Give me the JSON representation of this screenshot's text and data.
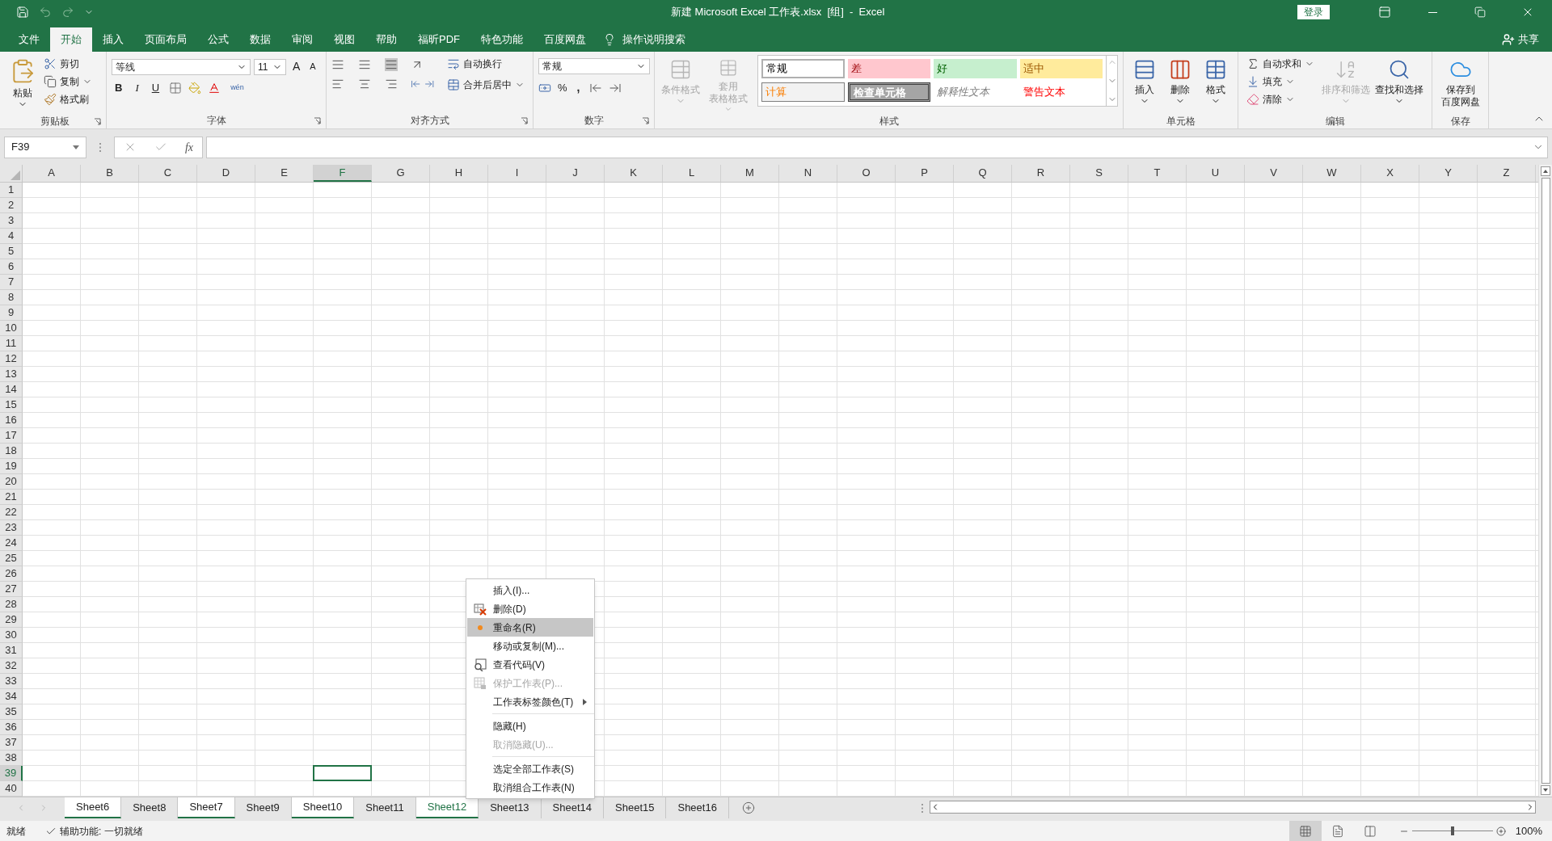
{
  "title_bar": {
    "title": "新建 Microsoft Excel 工作表.xlsx  [组]  -  Excel",
    "sign_in": "登录"
  },
  "menu_tabs": [
    {
      "label": "文件",
      "selected": false
    },
    {
      "label": "开始",
      "selected": true
    },
    {
      "label": "插入",
      "selected": false
    },
    {
      "label": "页面布局",
      "selected": false
    },
    {
      "label": "公式",
      "selected": false
    },
    {
      "label": "数据",
      "selected": false
    },
    {
      "label": "审阅",
      "selected": false
    },
    {
      "label": "视图",
      "selected": false
    },
    {
      "label": "帮助",
      "selected": false
    },
    {
      "label": "福昕PDF",
      "selected": false
    },
    {
      "label": "特色功能",
      "selected": false
    },
    {
      "label": "百度网盘",
      "selected": false
    }
  ],
  "tell_me": "操作说明搜索",
  "share": "共享",
  "ribbon": {
    "clipboard": {
      "label": "剪贴板",
      "paste": "粘贴",
      "cut": "剪切",
      "copy": "复制",
      "format_painter": "格式刷"
    },
    "font": {
      "label": "字体",
      "font_name": "等线",
      "font_size": "11",
      "grow": "A",
      "shrink": "A",
      "bold": "B",
      "italic": "I",
      "underline": "U",
      "phonetic": "wén"
    },
    "alignment": {
      "label": "对齐方式",
      "wrap_text": "自动换行",
      "merge_center": "合并后居中"
    },
    "number": {
      "label": "数字",
      "format": "常规",
      "percent": "%",
      "comma": ","
    },
    "styles": {
      "label": "样式",
      "conditional_formatting": {
        "label": "条件格式",
        "disabled": true
      },
      "format_as_table": {
        "label": "套用",
        "label2": "表格格式",
        "disabled": true
      },
      "cell_styles": [
        {
          "label": "常规",
          "kind": "normal"
        },
        {
          "label": "差",
          "kind": "bad"
        },
        {
          "label": "好",
          "kind": "good"
        },
        {
          "label": "适中",
          "kind": "neutral"
        },
        {
          "label": "计算",
          "kind": "calculation"
        },
        {
          "label": "检查单元格",
          "kind": "check"
        },
        {
          "label": "解释性文本",
          "kind": "explanatory"
        },
        {
          "label": "警告文本",
          "kind": "warning"
        }
      ]
    },
    "cells": {
      "label": "单元格",
      "insert": "插入",
      "delete": "删除",
      "format": "格式"
    },
    "editing": {
      "label": "编辑",
      "autosum": "自动求和",
      "fill": "填充",
      "clear": "清除",
      "sort_filter": {
        "label": "排序和筛选",
        "disabled": true
      },
      "find_select": "查找和选择"
    },
    "save": {
      "label": "保存",
      "button": "保存到",
      "button2": "百度网盘"
    }
  },
  "formula_bar": {
    "name_box": "F39",
    "fx": "fx"
  },
  "columns": [
    {
      "label": "A",
      "selected": false
    },
    {
      "label": "B",
      "selected": false
    },
    {
      "label": "C",
      "selected": false
    },
    {
      "label": "D",
      "selected": false
    },
    {
      "label": "E",
      "selected": false
    },
    {
      "label": "F",
      "selected": true
    },
    {
      "label": "G",
      "selected": false
    },
    {
      "label": "H",
      "selected": false
    },
    {
      "label": "I",
      "selected": false
    },
    {
      "label": "J",
      "selected": false
    },
    {
      "label": "K",
      "selected": false
    },
    {
      "label": "L",
      "selected": false
    },
    {
      "label": "M",
      "selected": false
    },
    {
      "label": "N",
      "selected": false
    },
    {
      "label": "O",
      "selected": false
    },
    {
      "label": "P",
      "selected": false
    },
    {
      "label": "Q",
      "selected": false
    },
    {
      "label": "R",
      "selected": false
    },
    {
      "label": "S",
      "selected": false
    },
    {
      "label": "T",
      "selected": false
    },
    {
      "label": "U",
      "selected": false
    },
    {
      "label": "V",
      "selected": false
    },
    {
      "label": "W",
      "selected": false
    },
    {
      "label": "X",
      "selected": false
    },
    {
      "label": "Y",
      "selected": false
    },
    {
      "label": "Z",
      "selected": false
    }
  ],
  "rows": [
    {
      "label": "1",
      "selected": false
    },
    {
      "label": "2",
      "selected": false
    },
    {
      "label": "3",
      "selected": false
    },
    {
      "label": "4",
      "selected": false
    },
    {
      "label": "5",
      "selected": false
    },
    {
      "label": "6",
      "selected": false
    },
    {
      "label": "7",
      "selected": false
    },
    {
      "label": "8",
      "selected": false
    },
    {
      "label": "9",
      "selected": false
    },
    {
      "label": "10",
      "selected": false
    },
    {
      "label": "11",
      "selected": false
    },
    {
      "label": "12",
      "selected": false
    },
    {
      "label": "13",
      "selected": false
    },
    {
      "label": "14",
      "selected": false
    },
    {
      "label": "15",
      "selected": false
    },
    {
      "label": "16",
      "selected": false
    },
    {
      "label": "17",
      "selected": false
    },
    {
      "label": "18",
      "selected": false
    },
    {
      "label": "19",
      "selected": false
    },
    {
      "label": "20",
      "selected": false
    },
    {
      "label": "21",
      "selected": false
    },
    {
      "label": "22",
      "selected": false
    },
    {
      "label": "23",
      "selected": false
    },
    {
      "label": "24",
      "selected": false
    },
    {
      "label": "25",
      "selected": false
    },
    {
      "label": "26",
      "selected": false
    },
    {
      "label": "27",
      "selected": false
    },
    {
      "label": "28",
      "selected": false
    },
    {
      "label": "29",
      "selected": false
    },
    {
      "label": "30",
      "selected": false
    },
    {
      "label": "31",
      "selected": false
    },
    {
      "label": "32",
      "selected": false
    },
    {
      "label": "33",
      "selected": false
    },
    {
      "label": "34",
      "selected": false
    },
    {
      "label": "35",
      "selected": false
    },
    {
      "label": "36",
      "selected": false
    },
    {
      "label": "37",
      "selected": false
    },
    {
      "label": "38",
      "selected": false
    },
    {
      "label": "39",
      "selected": true
    },
    {
      "label": "40",
      "selected": false
    }
  ],
  "context_menu": [
    {
      "kind": "item",
      "label": "插入(I)...",
      "disabled": false,
      "selected": false
    },
    {
      "kind": "delete",
      "label": "删除(D)",
      "disabled": false,
      "selected": false
    },
    {
      "kind": "rename",
      "label": "重命名(R)",
      "disabled": false,
      "selected": true
    },
    {
      "kind": "item",
      "label": "移动或复制(M)...",
      "disabled": false,
      "selected": false
    },
    {
      "kind": "code",
      "label": "查看代码(V)",
      "disabled": false,
      "selected": false
    },
    {
      "kind": "protect",
      "label": "保护工作表(P)...",
      "disabled": true,
      "selected": false
    },
    {
      "kind": "submenu",
      "label": "工作表标签颜色(T)",
      "disabled": false,
      "selected": false
    },
    {
      "kind": "separator"
    },
    {
      "kind": "item",
      "label": "隐藏(H)",
      "disabled": false,
      "selected": false
    },
    {
      "kind": "item",
      "label": "取消隐藏(U)...",
      "disabled": true,
      "selected": false
    },
    {
      "kind": "separator"
    },
    {
      "kind": "item",
      "label": "选定全部工作表(S)",
      "disabled": false,
      "selected": false
    },
    {
      "kind": "item",
      "label": "取消组合工作表(N)",
      "disabled": false,
      "selected": false
    }
  ],
  "sheet_tabs": [
    {
      "label": "Sheet6",
      "selected": true,
      "active": false
    },
    {
      "label": "Sheet8",
      "selected": false,
      "active": false
    },
    {
      "label": "Sheet7",
      "selected": true,
      "active": false
    },
    {
      "label": "Sheet9",
      "selected": false,
      "active": false
    },
    {
      "label": "Sheet10",
      "selected": true,
      "active": false
    },
    {
      "label": "Sheet11",
      "selected": false,
      "active": false
    },
    {
      "label": "Sheet12",
      "selected": true,
      "active": true
    },
    {
      "label": "Sheet13",
      "selected": false,
      "active": false
    },
    {
      "label": "Sheet14",
      "selected": false,
      "active": false
    },
    {
      "label": "Sheet15",
      "selected": false,
      "active": false
    },
    {
      "label": "Sheet16",
      "selected": false,
      "active": false
    }
  ],
  "status_bar": {
    "status": "就绪",
    "accessibility": "辅助功能: 一切就绪",
    "views": [
      {
        "kind": "normal",
        "selected": true
      },
      {
        "kind": "page_layout",
        "selected": false
      },
      {
        "kind": "page_break",
        "selected": false
      }
    ],
    "level": 0.5,
    "zoom": "100%"
  }
}
